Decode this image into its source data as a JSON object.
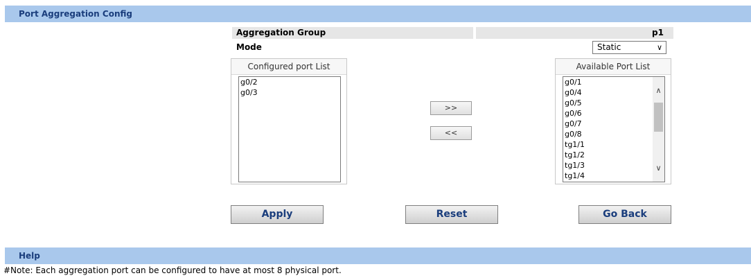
{
  "header": {
    "title": "Port Aggregation Config"
  },
  "aggregation_group": {
    "label": "Aggregation Group",
    "value": "p1"
  },
  "mode": {
    "label": "Mode",
    "selected": "Static"
  },
  "configured_list": {
    "title": "Configured port List",
    "items": [
      "g0/2",
      "g0/3"
    ]
  },
  "available_list": {
    "title": "Available Port List",
    "items": [
      "g0/1",
      "g0/4",
      "g0/5",
      "g0/6",
      "g0/7",
      "g0/8",
      "tg1/1",
      "tg1/2",
      "tg1/3",
      "tg1/4"
    ]
  },
  "move_buttons": {
    "add": ">>",
    "remove": "<<"
  },
  "actions": {
    "apply": "Apply",
    "reset": "Reset",
    "back": "Go Back"
  },
  "help": {
    "title": "Help",
    "note": "#Note: Each aggregation port can be configured to have at most 8 physical port."
  }
}
